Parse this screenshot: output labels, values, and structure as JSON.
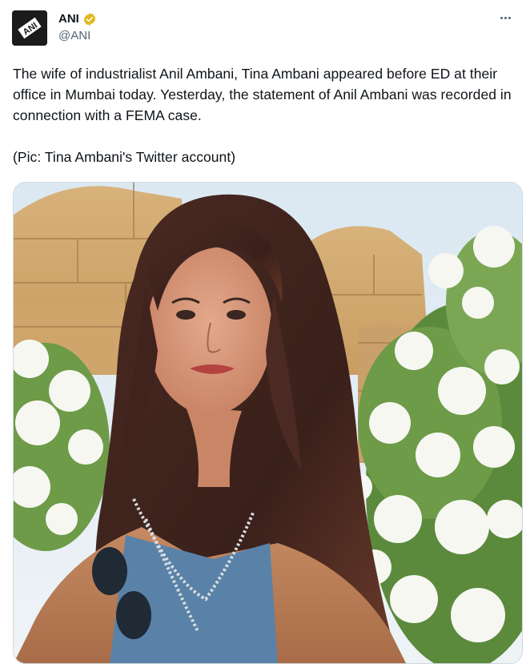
{
  "tweet": {
    "author_name": "ANI",
    "handle": "@ANI",
    "text_line_1": "The wife of industrialist Anil Ambani, Tina Ambani appeared before ED at their office in Mumbai today. Yesterday, the statement of Anil Ambani was recorded in connection with a FEMA case.",
    "text_line_2": "(Pic: Tina Ambani's Twitter account)",
    "avatar_logo_text": "ANI",
    "verified_color": "#e2b719",
    "icons": {
      "verified": "verified-badge-icon",
      "more": "more-options-icon"
    },
    "media": {
      "type": "photo"
    }
  }
}
